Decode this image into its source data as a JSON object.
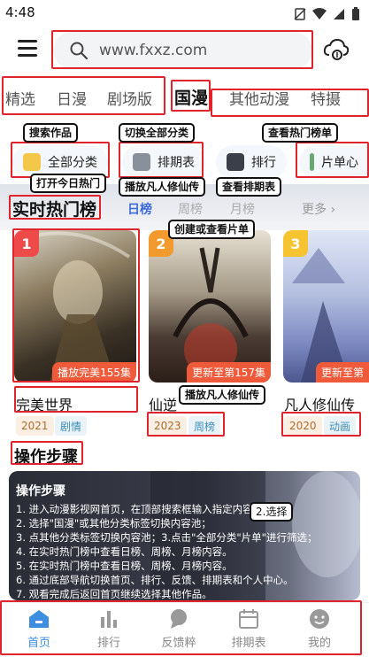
{
  "status_bar": {
    "time": "4:48"
  },
  "header": {
    "search_placeholder": "www.fxxz.com"
  },
  "tabs": [
    "精选",
    "日漫",
    "剧场版",
    "国漫",
    "其他动漫",
    "特摄"
  ],
  "quick_chips": [
    "全部分类",
    "排期表",
    "排行",
    "片单心"
  ],
  "hot": {
    "title": "实时热门榜",
    "tabs": [
      "日榜",
      "周榜",
      "月榜"
    ],
    "more": "更多 ›",
    "cards": [
      {
        "rank": "1",
        "status": "播放完美155集",
        "title": "完美世界",
        "year": "2021",
        "genre": "剧情"
      },
      {
        "rank": "2",
        "status": "更新至第157集",
        "title": "仙逆",
        "year": "2023",
        "genre": "周榜"
      },
      {
        "rank": "3",
        "status": "更新至第",
        "title": "凡人修仙传",
        "year": "2020",
        "genre": "动画"
      }
    ]
  },
  "steps": {
    "section_title": "操作步骤",
    "heading": "操作步骤",
    "lines": [
      "1. 进入动漫影视网首页，在顶部搜索框输入指定内容；",
      "2. 选择\"国漫\"或其他分类标签切换内容池；",
      "3. 点其他分类标签切换内容池；3.点击\"全部分类\"片单\"进行筛选；",
      "4. 在实时热门榜中查看日榜、周榜、月榜内容。",
      "5. 在实时热门榜中查看日榜、周榜、月榜内容。",
      "6. 通过底部导航切换首页、排行、反馈、排期表和个人中心。",
      "7. 观看完成后返回首页继续选择其他作品。"
    ],
    "overlay_label": "2.选择"
  },
  "annotations": {
    "search_works": "搜索作品",
    "switch_all": "切换全部分类",
    "view_hot": "查看热门榜单",
    "open_today": "打开今日热门",
    "play_fanren": "播放凡人修仙传",
    "view_schedule": "查看排期表",
    "create_list": "创建或查看片单",
    "play_fanren_2": "播放凡人修仙传"
  },
  "bottom_nav": [
    "首页",
    "排行",
    "反馈粹",
    "排期表",
    "我的"
  ],
  "colors": {
    "accent": "#3d8ee0",
    "annotation_red": "#e0242d"
  }
}
